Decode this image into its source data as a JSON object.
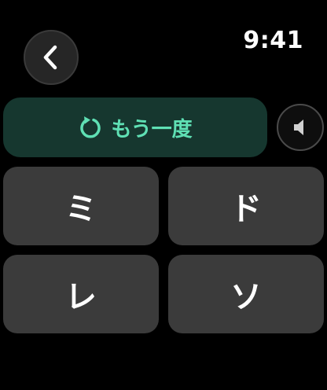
{
  "status_bar": {
    "time": "9:41"
  },
  "header": {
    "back_icon": "chevron-left-icon"
  },
  "replay": {
    "icon": "replay-icon",
    "label": "もう一度",
    "accent_color": "#5fe0b4",
    "background_color": "#16372f"
  },
  "sound": {
    "icon": "speaker-icon"
  },
  "answers": [
    {
      "label": "ミ"
    },
    {
      "label": "ド"
    },
    {
      "label": "レ"
    },
    {
      "label": "ソ"
    }
  ]
}
